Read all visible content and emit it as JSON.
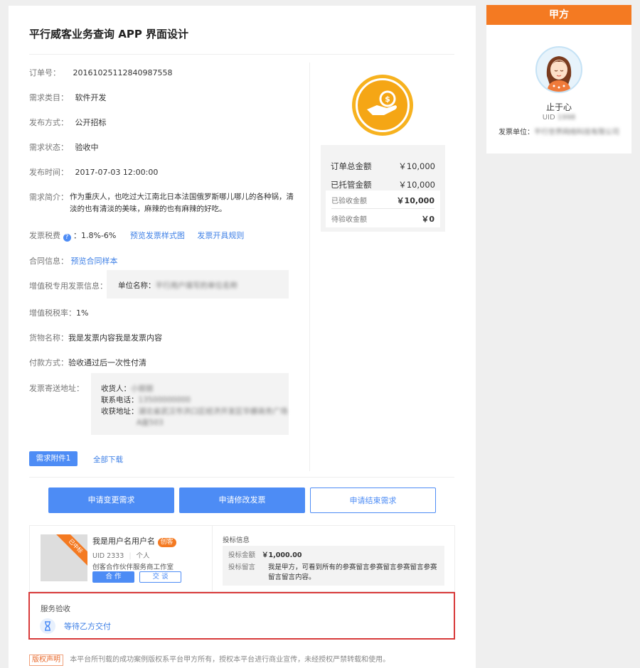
{
  "title": "平行威客业务查询 APP 界面设计",
  "fields": {
    "order_no_label": "订单号：",
    "order_no": "20161025112840987558",
    "category_label": "需求类目：",
    "category": "软件开发",
    "method_label": "发布方式：",
    "method": "公开招标",
    "status_label": "需求状态：",
    "status": "验收中",
    "time_label": "发布时间：",
    "time": "2017-07-03 12:00:00",
    "intro_label": "需求简介：",
    "intro_line1": "作为重庆人，也吃过大江南北日本法国俄罗斯哪儿哪儿的各种锅，清",
    "intro_line2": "淡的也有清淡的美味，麻辣的也有麻辣的好吃。",
    "tax_label": "发票税费",
    "tax_value": "：1.8%-6%",
    "tax_link1": "预览发票样式图",
    "tax_link2": "发票开具规则",
    "contract_label": "合同信息：",
    "contract_link": "预览合同样本",
    "vat_label": "增值税专用发票信息：",
    "vat_unit_label": "单位名称：",
    "vat_unit_value": "平行用户填写的单位名称",
    "vat_rate_label": "增值税税率：",
    "vat_rate": "1%",
    "goods_label": "货物名称：",
    "goods": "我是发票内容我是发票内容",
    "pay_label": "付款方式：",
    "pay": "验收通过后一次性付清",
    "addr_label": "发票寄送地址：",
    "recv_label": "收货人：",
    "recv_value": "小丽丽",
    "phone_label": "联系电话：",
    "phone_value": "13500000000",
    "addr2_label": "收获地址：",
    "addr2_line1": "湖北省武汉市洪口区经济开发区华娜商务广场",
    "addr2_line2": "A座503"
  },
  "attachments": {
    "tag": "需求附件1",
    "download": "全部下载"
  },
  "money": {
    "total_label": "订单总金额",
    "total": "￥10,000",
    "escrow_label": "已托管金额",
    "escrow": "￥10,000",
    "accepted_label": "已验收金额",
    "accepted": "￥10,000",
    "pending_label": "待验收金额",
    "pending": "￥0"
  },
  "actions": {
    "change": "申请变更需求",
    "invoice": "申请修改发票",
    "end": "申请结束需求"
  },
  "bidder": {
    "ribbon": "已中标",
    "name": "我是用户名用户名",
    "badge": "创客",
    "uid": "UID 2333",
    "type": "个人",
    "company": "创客合作伙伴服务商工作室",
    "coop_btn": "合 作",
    "talk_btn": "交 谈",
    "bid_title": "投标信息",
    "amount_label": "投标金额",
    "amount": "￥1,000.00",
    "msg_label": "投标留言",
    "msg_line1": "我是甲方，可看到所有的参赛留言参赛留言参赛留言参赛",
    "msg_line2": "留言留言内容。"
  },
  "acceptance": {
    "title": "服务验收",
    "status": "等待乙方交付"
  },
  "copyright": {
    "badge": "版权声明",
    "text": "本平台所刊载的成功案例版权系平台甲方所有，授权本平台进行商业宣传，未经授权严禁转载和使用。"
  },
  "side": {
    "header": "甲方",
    "name": "止于心",
    "uid_label": "UID",
    "uid": "1998",
    "unit_label": "发票单位：",
    "unit": "平行世界网络科技有限公司"
  }
}
